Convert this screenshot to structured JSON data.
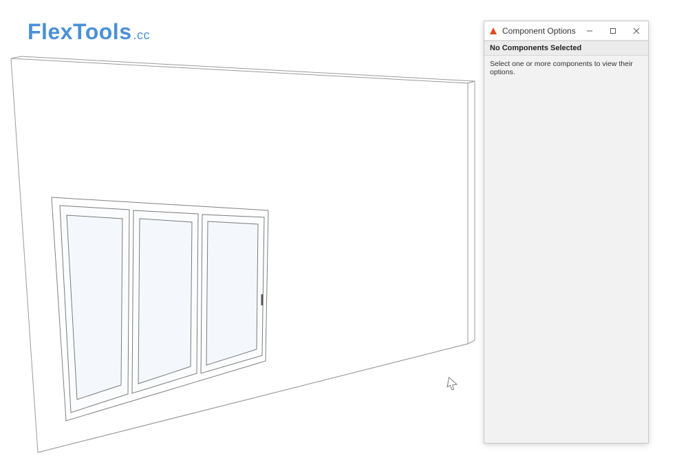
{
  "logo": {
    "text_main": "FlexTools",
    "text_suffix": ".cc"
  },
  "dialog": {
    "title": "Component Options",
    "subhead": "No Components Selected",
    "body_text": "Select one or more components to view their options."
  }
}
